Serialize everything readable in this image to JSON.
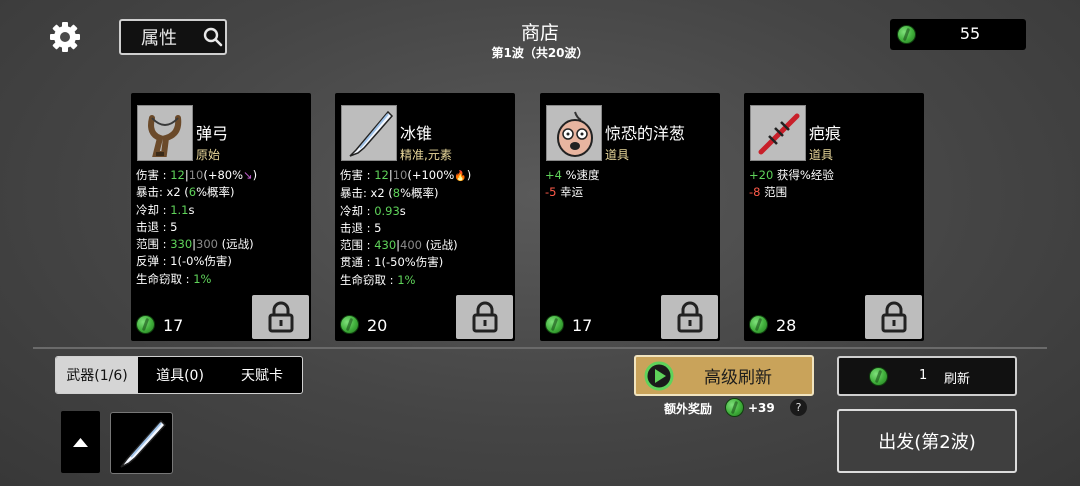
{
  "header": {
    "title": "商店",
    "wave": "第1波（共20波）",
    "attribute_label": "属性",
    "money": "55"
  },
  "shop": {
    "cards": [
      {
        "name": "弹弓",
        "category": "原始",
        "icon": "slingshot-icon",
        "price": "17",
        "stats": [
          [
            [
              "伤害 : ",
              ""
            ],
            [
              "12",
              "g"
            ],
            [
              "|",
              ""
            ],
            [
              "10",
              "d"
            ],
            [
              "(+80%",
              ""
            ],
            [
              "↘",
              "p"
            ],
            [
              ")",
              ""
            ]
          ],
          [
            [
              "暴击:  x2  (",
              ""
            ],
            [
              "6",
              "g"
            ],
            [
              "%概率)",
              ""
            ]
          ],
          [
            [
              "冷却 : ",
              ""
            ],
            [
              "1.1",
              "g"
            ],
            [
              "s",
              ""
            ]
          ],
          [
            [
              "击退 : 5",
              ""
            ]
          ],
          [
            [
              "范围 : ",
              ""
            ],
            [
              "330",
              "g"
            ],
            [
              "|",
              ""
            ],
            [
              "300",
              "d"
            ],
            [
              " (远战)",
              ""
            ]
          ],
          [
            [
              "反弹 : 1(-0%伤害)",
              ""
            ]
          ],
          [
            [
              "生命窃取 : ",
              ""
            ],
            [
              "1%",
              "g"
            ]
          ]
        ]
      },
      {
        "name": "冰锥",
        "category": "精准,元素",
        "icon": "icicle-icon",
        "price": "20",
        "stats": [
          [
            [
              "伤害 : ",
              ""
            ],
            [
              "12",
              "g"
            ],
            [
              "|",
              ""
            ],
            [
              "10",
              "d"
            ],
            [
              "(+100%",
              ""
            ],
            [
              "🔥",
              "f"
            ],
            [
              ")",
              ""
            ]
          ],
          [
            [
              "暴击:  x2  (",
              ""
            ],
            [
              "8",
              "g"
            ],
            [
              "%概率)",
              ""
            ]
          ],
          [
            [
              "冷却 : ",
              ""
            ],
            [
              "0.93",
              "g"
            ],
            [
              "s",
              ""
            ]
          ],
          [
            [
              "击退 : 5",
              ""
            ]
          ],
          [
            [
              "范围 : ",
              ""
            ],
            [
              "430",
              "g"
            ],
            [
              "|",
              ""
            ],
            [
              "400",
              "d"
            ],
            [
              " (远战)",
              ""
            ]
          ],
          [
            [
              "贯通 : 1(-50%伤害)",
              ""
            ]
          ],
          [
            [
              "生命窃取 : ",
              ""
            ],
            [
              "1%",
              "g"
            ]
          ]
        ]
      },
      {
        "name": "惊恐的洋葱",
        "category": "道具",
        "icon": "scared-onion-icon",
        "price": "17",
        "stats": [
          [
            [
              "+4",
              "g"
            ],
            [
              " %速度",
              ""
            ]
          ],
          [
            [
              "-5",
              "r"
            ],
            [
              " 幸运",
              ""
            ]
          ]
        ]
      },
      {
        "name": "疤痕",
        "category": "道具",
        "icon": "scar-icon",
        "price": "28",
        "stats": [
          [
            [
              "+20",
              "g"
            ],
            [
              " 获得%经验",
              ""
            ]
          ],
          [
            [
              "-8",
              "r"
            ],
            [
              " 范围",
              ""
            ]
          ]
        ]
      }
    ]
  },
  "tabs": [
    {
      "label": "武器(1/6)",
      "active": true
    },
    {
      "label": "道具(0)",
      "active": false
    },
    {
      "label": "天赋卡",
      "active": false
    }
  ],
  "advanced_refresh": {
    "label": "高级刷新",
    "bonus_label": "额外奖励",
    "bonus_value": "+39",
    "help": "?"
  },
  "refresh": {
    "count": "1",
    "label": "刷新"
  },
  "go": {
    "label": "出发(第2波)"
  },
  "colors": {
    "green": "#5fd35a",
    "red": "#ff5b4a",
    "gold_button": "#c9a35a",
    "category": "#e8d79a"
  }
}
